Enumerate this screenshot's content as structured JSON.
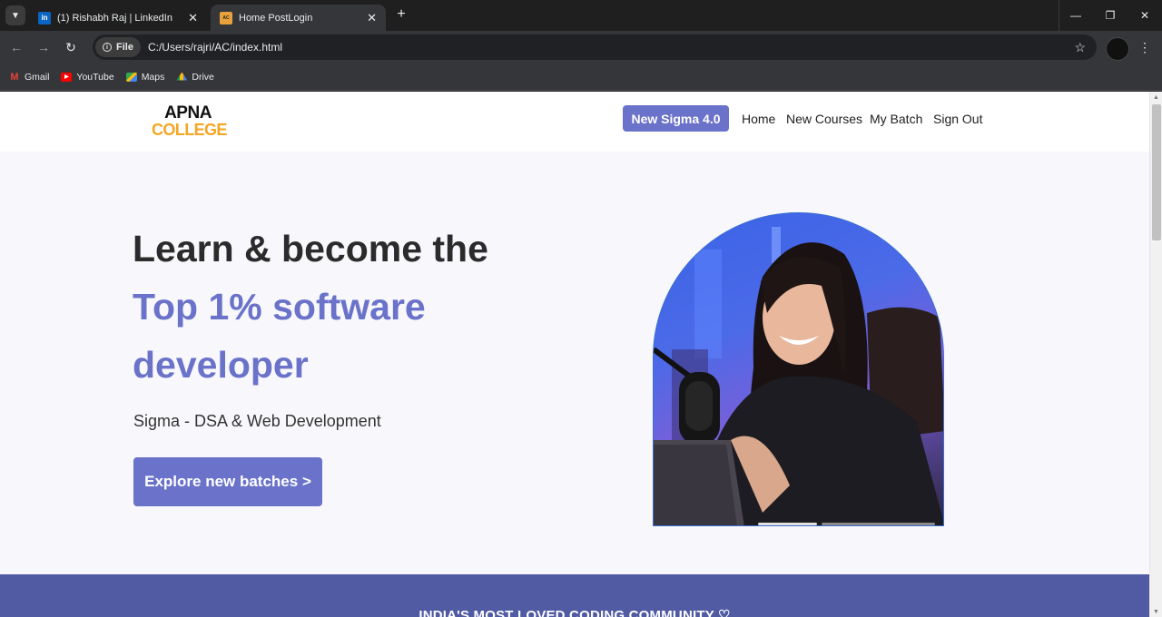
{
  "browser": {
    "tabs": [
      {
        "title": "(1) Rishabh Raj | LinkedIn",
        "favicon": "in",
        "active": false
      },
      {
        "title": "Home PostLogin",
        "favicon": "AC",
        "active": true
      }
    ],
    "address_chip": "File",
    "url": "C:/Users/rajri/AC/index.html",
    "bookmarks": [
      {
        "label": "Gmail",
        "icon": "gmail-icon"
      },
      {
        "label": "YouTube",
        "icon": "youtube-icon"
      },
      {
        "label": "Maps",
        "icon": "maps-icon"
      },
      {
        "label": "Drive",
        "icon": "drive-icon"
      }
    ]
  },
  "site": {
    "logo": {
      "line1": "APNA",
      "line2": "COLLEGE"
    },
    "nav": {
      "cta": "New Sigma 4.0",
      "links": [
        "Home",
        "New Courses",
        "My Batch",
        "Sign Out"
      ]
    },
    "hero": {
      "line1": "Learn & become the",
      "line2": "Top 1% software",
      "line3": "developer",
      "subtitle": "Sigma - DSA & Web Development",
      "button": "Explore new batches >"
    },
    "band": {
      "text": "INDIA'S MOST LOVED CODING COMMUNITY ♡"
    }
  },
  "colors": {
    "accent": "#6a72c9",
    "band": "#515ba3",
    "logo_orange": "#f5a623"
  }
}
